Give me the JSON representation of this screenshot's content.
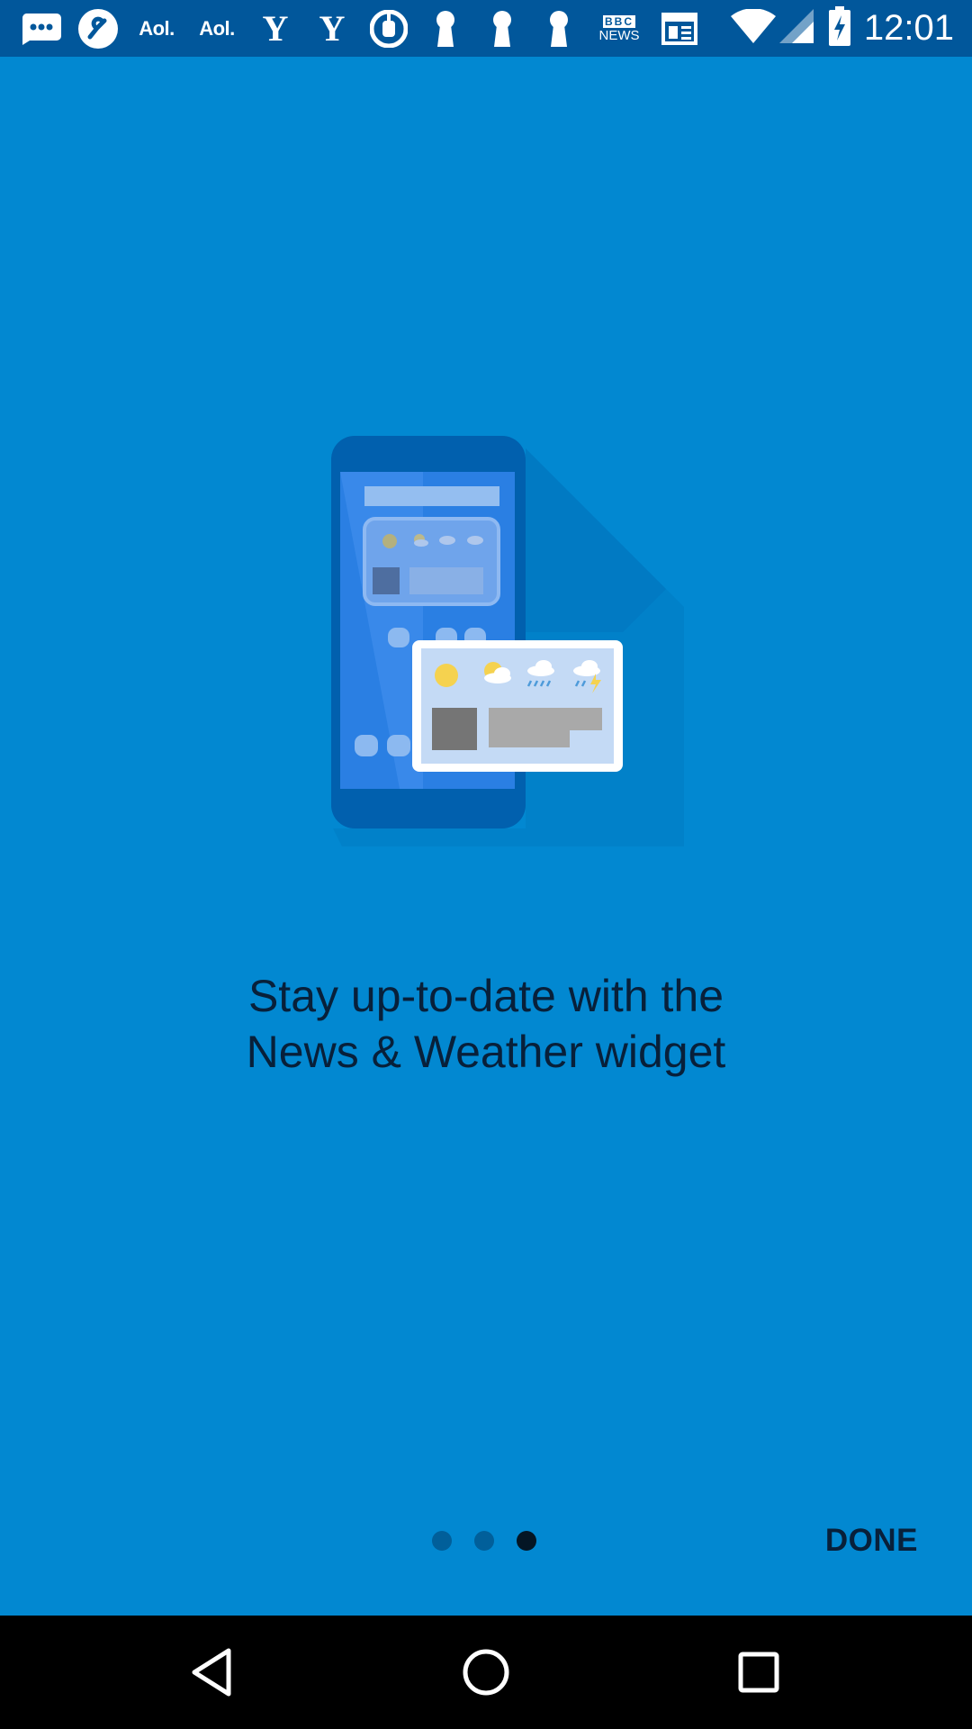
{
  "status_bar": {
    "time": "12:01",
    "notifications": [
      {
        "icon": "messaging-icon"
      },
      {
        "icon": "linkedin-icon"
      },
      {
        "icon": "aol-icon",
        "text": "Aol."
      },
      {
        "icon": "aol-icon",
        "text": "Aol."
      },
      {
        "icon": "yahoo-icon",
        "text": "Y"
      },
      {
        "icon": "yahoo-icon",
        "text": "Y"
      },
      {
        "icon": "daily-mail-icon"
      },
      {
        "icon": "keyhole-icon"
      },
      {
        "icon": "keyhole-icon"
      },
      {
        "icon": "keyhole-icon"
      },
      {
        "icon": "bbc-news-icon",
        "text_top": "BBC",
        "text_bottom": "NEWS"
      },
      {
        "icon": "newspaper-icon"
      }
    ],
    "system_icons": [
      "wifi-icon",
      "signal-icon",
      "battery-charging-icon"
    ]
  },
  "onboarding": {
    "headline_line1": "Stay up-to-date with the",
    "headline_line2": "News & Weather widget",
    "done_label": "DONE",
    "pages_total": 3,
    "current_page": 3
  },
  "nav_bar": {
    "buttons": [
      "back-icon",
      "home-icon",
      "recents-icon"
    ]
  },
  "colors": {
    "background": "#0288D1",
    "status_bar": "#01579B",
    "text": "#08203a",
    "dot_inactive": "#015F9A",
    "dot_active": "#041625"
  }
}
